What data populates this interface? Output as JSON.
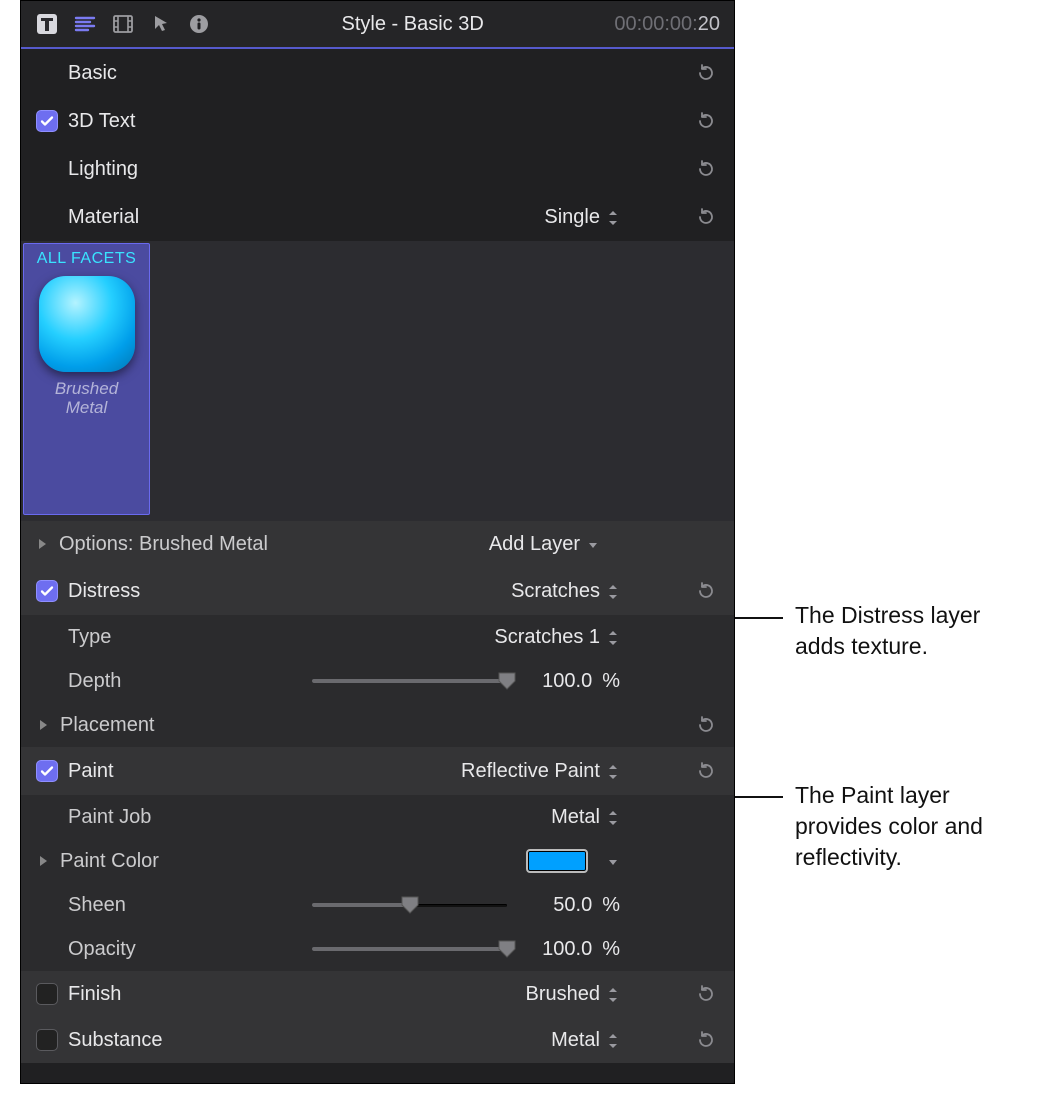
{
  "header": {
    "title": "Style - Basic 3D",
    "timecode_prefix": "00:00:00:",
    "timecode_frames": "20"
  },
  "sections": {
    "basic": "Basic",
    "text3d": "3D Text",
    "lighting": "Lighting",
    "material": "Material",
    "material_value": "Single"
  },
  "swatch": {
    "header": "ALL FACETS",
    "name_l1": "Brushed",
    "name_l2": "Metal"
  },
  "options": {
    "label": "Options: Brushed Metal",
    "add_layer": "Add Layer"
  },
  "distress": {
    "label": "Distress",
    "value": "Scratches",
    "type_label": "Type",
    "type_value": "Scratches 1",
    "depth_label": "Depth",
    "depth_value": "100.0",
    "depth_unit": "%",
    "placement_label": "Placement"
  },
  "paint": {
    "label": "Paint",
    "value": "Reflective Paint",
    "job_label": "Paint Job",
    "job_value": "Metal",
    "color_label": "Paint Color",
    "color_hex": "#00A0FF",
    "sheen_label": "Sheen",
    "sheen_value": "50.0",
    "sheen_unit": "%",
    "opacity_label": "Opacity",
    "opacity_value": "100.0",
    "opacity_unit": "%"
  },
  "finish": {
    "label": "Finish",
    "value": "Brushed"
  },
  "substance": {
    "label": "Substance",
    "value": "Metal"
  },
  "annotations": {
    "distress": "The Distress layer adds texture.",
    "paint": "The Paint layer provides color and reflectivity."
  }
}
